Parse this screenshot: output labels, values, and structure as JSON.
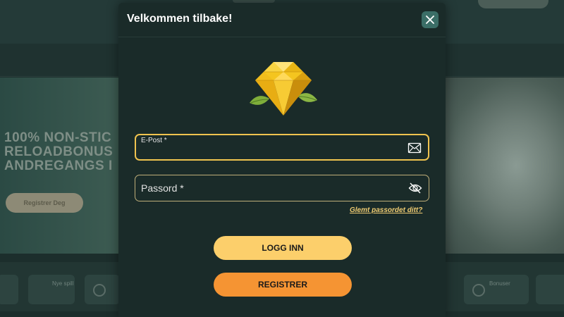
{
  "background": {
    "hero_text": "100% NON-STIC\nRELOADBONUS\nANDREGANGS I",
    "hero_button": "Registrer Deg",
    "bottom_tiles": [
      "Topp spill",
      "Nye spill",
      "",
      "",
      "Bonuser"
    ]
  },
  "modal": {
    "title": "Velkommen tilbake!",
    "close_icon": "close-icon",
    "email": {
      "label": "E-Post *",
      "value": "",
      "icon": "envelope-icon"
    },
    "password": {
      "placeholder": "Passord *",
      "icon": "eye-off-icon"
    },
    "forgot_link": "Glemt passordet ditt?",
    "login_button": "LOGG INN",
    "register_button": "REGISTRER"
  },
  "colors": {
    "modal_bg": "#1a2b29",
    "accent_yellow": "#fccf6b",
    "accent_orange": "#f59433",
    "close_bg": "#3b6e67"
  }
}
